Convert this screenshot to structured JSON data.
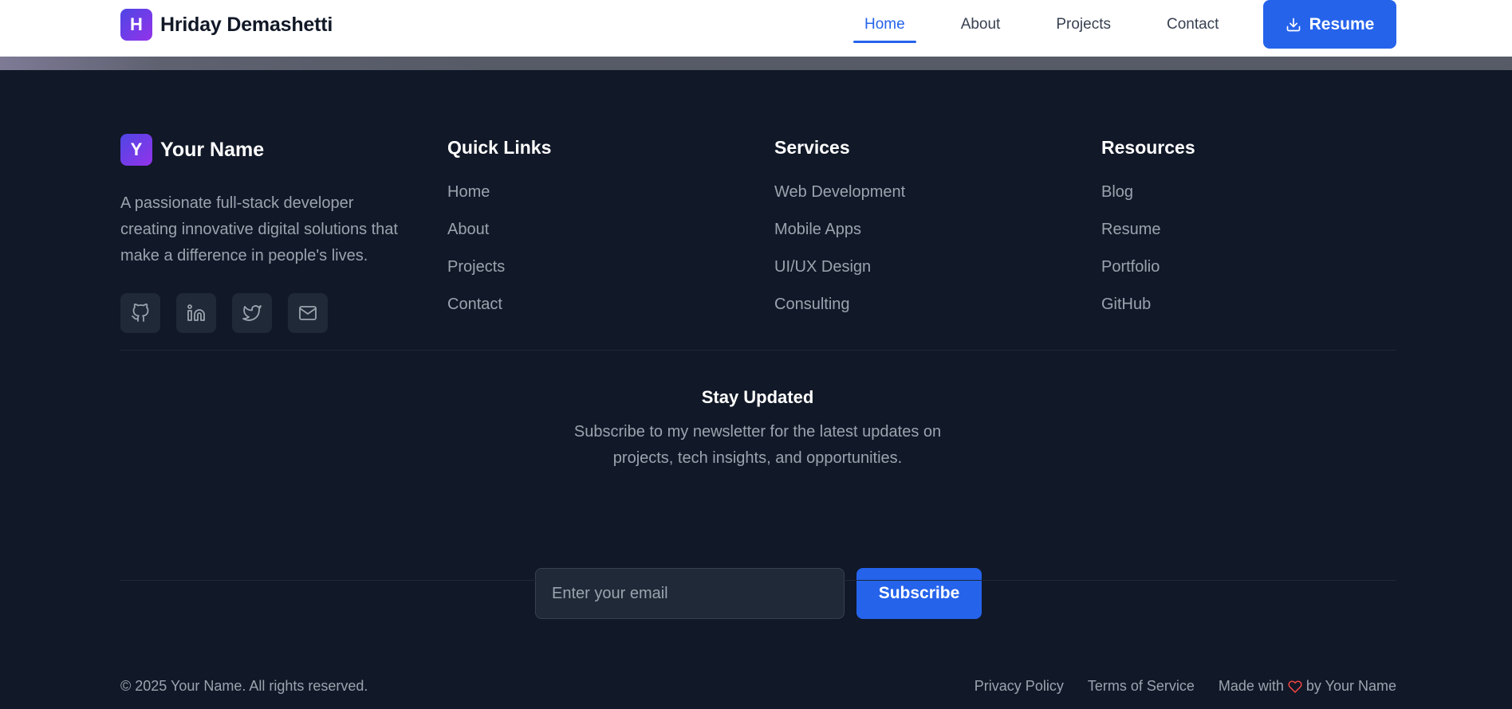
{
  "header": {
    "logo_letter": "H",
    "brand_name": "Hriday Demashetti",
    "nav": [
      "Home",
      "About",
      "Projects",
      "Contact"
    ],
    "active_nav": "Home",
    "resume_label": "Resume"
  },
  "footer": {
    "logo_letter": "Y",
    "brand_name": "Your Name",
    "description": "A passionate full-stack developer creating innovative digital solutions that make a difference in people's lives.",
    "socials": [
      "github-icon",
      "linkedin-icon",
      "twitter-icon",
      "mail-icon"
    ],
    "columns": [
      {
        "title": "Quick Links",
        "links": [
          "Home",
          "About",
          "Projects",
          "Contact"
        ]
      },
      {
        "title": "Services",
        "links": [
          "Web Development",
          "Mobile Apps",
          "UI/UX Design",
          "Consulting"
        ]
      },
      {
        "title": "Resources",
        "links": [
          "Blog",
          "Resume",
          "Portfolio",
          "GitHub"
        ]
      }
    ],
    "newsletter": {
      "title": "Stay Updated",
      "description": "Subscribe to my newsletter for the latest updates on projects, tech insights, and opportunities.",
      "placeholder": "Enter your email",
      "button": "Subscribe"
    },
    "copyright": "© 2025 Your Name. All rights reserved.",
    "privacy": "Privacy Policy",
    "terms": "Terms of Service",
    "made_with_prefix": "Made with",
    "made_with_suffix": "by Your Name"
  },
  "colors": {
    "accent": "#2563eb",
    "footer_bg": "#111827",
    "heart": "#ef4444"
  }
}
